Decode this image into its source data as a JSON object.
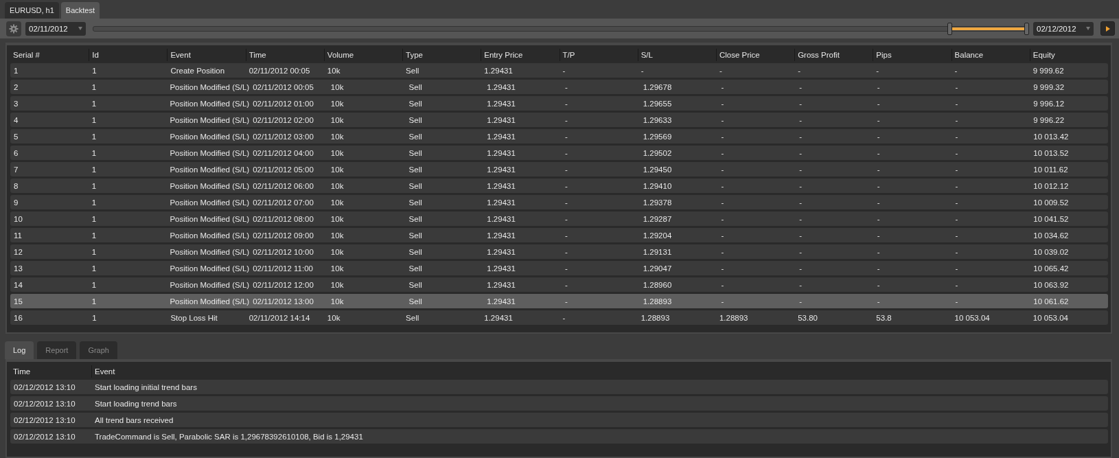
{
  "top_tabs": [
    {
      "label": "EURUSD, h1",
      "selected": false
    },
    {
      "label": "Backtest",
      "selected": true
    }
  ],
  "toolbar": {
    "start_date": "02/11/2012",
    "end_date": "02/12/2012",
    "range_slider": {
      "level": 0.08
    }
  },
  "trades": {
    "columns": [
      "Serial #",
      "Id",
      "Event",
      "Time",
      "Volume",
      "Type",
      "Entry Price",
      "T/P",
      "S/L",
      "Close Price",
      "Gross Profit",
      "Pips",
      "Balance",
      "Equity"
    ],
    "rows": [
      {
        "selected": false,
        "cells": [
          "1",
          "1",
          "Create Position",
          "02/11/2012 00:05",
          "10k",
          "Sell",
          "1.29431",
          "-",
          "-",
          "-",
          "-",
          "-",
          "-",
          "9 999.62"
        ]
      },
      {
        "selected": false,
        "cells": [
          "2",
          "1",
          "Position Modified (S/L)",
          "02/11/2012 00:05",
          "10k",
          "Sell",
          "1.29431",
          "-",
          "1.29678",
          "-",
          "-",
          "-",
          "-",
          "9 999.32"
        ]
      },
      {
        "selected": false,
        "cells": [
          "3",
          "1",
          "Position Modified (S/L)",
          "02/11/2012 01:00",
          "10k",
          "Sell",
          "1.29431",
          "-",
          "1.29655",
          "-",
          "-",
          "-",
          "-",
          "9 996.12"
        ]
      },
      {
        "selected": false,
        "cells": [
          "4",
          "1",
          "Position Modified (S/L)",
          "02/11/2012 02:00",
          "10k",
          "Sell",
          "1.29431",
          "-",
          "1.29633",
          "-",
          "-",
          "-",
          "-",
          "9 996.22"
        ]
      },
      {
        "selected": false,
        "cells": [
          "5",
          "1",
          "Position Modified (S/L)",
          "02/11/2012 03:00",
          "10k",
          "Sell",
          "1.29431",
          "-",
          "1.29569",
          "-",
          "-",
          "-",
          "-",
          "10 013.42"
        ]
      },
      {
        "selected": false,
        "cells": [
          "6",
          "1",
          "Position Modified (S/L)",
          "02/11/2012 04:00",
          "10k",
          "Sell",
          "1.29431",
          "-",
          "1.29502",
          "-",
          "-",
          "-",
          "-",
          "10 013.52"
        ]
      },
      {
        "selected": false,
        "cells": [
          "7",
          "1",
          "Position Modified (S/L)",
          "02/11/2012 05:00",
          "10k",
          "Sell",
          "1.29431",
          "-",
          "1.29450",
          "-",
          "-",
          "-",
          "-",
          "10 011.62"
        ]
      },
      {
        "selected": false,
        "cells": [
          "8",
          "1",
          "Position Modified (S/L)",
          "02/11/2012 06:00",
          "10k",
          "Sell",
          "1.29431",
          "-",
          "1.29410",
          "-",
          "-",
          "-",
          "-",
          "10 012.12"
        ]
      },
      {
        "selected": false,
        "cells": [
          "9",
          "1",
          "Position Modified (S/L)",
          "02/11/2012 07:00",
          "10k",
          "Sell",
          "1.29431",
          "-",
          "1.29378",
          "-",
          "-",
          "-",
          "-",
          "10 009.52"
        ]
      },
      {
        "selected": false,
        "cells": [
          "10",
          "1",
          "Position Modified (S/L)",
          "02/11/2012 08:00",
          "10k",
          "Sell",
          "1.29431",
          "-",
          "1.29287",
          "-",
          "-",
          "-",
          "-",
          "10 041.52"
        ]
      },
      {
        "selected": false,
        "cells": [
          "11",
          "1",
          "Position Modified (S/L)",
          "02/11/2012 09:00",
          "10k",
          "Sell",
          "1.29431",
          "-",
          "1.29204",
          "-",
          "-",
          "-",
          "-",
          "10 034.62"
        ]
      },
      {
        "selected": false,
        "cells": [
          "12",
          "1",
          "Position Modified (S/L)",
          "02/11/2012 10:00",
          "10k",
          "Sell",
          "1.29431",
          "-",
          "1.29131",
          "-",
          "-",
          "-",
          "-",
          "10 039.02"
        ]
      },
      {
        "selected": false,
        "cells": [
          "13",
          "1",
          "Position Modified (S/L)",
          "02/11/2012 11:00",
          "10k",
          "Sell",
          "1.29431",
          "-",
          "1.29047",
          "-",
          "-",
          "-",
          "-",
          "10 065.42"
        ]
      },
      {
        "selected": false,
        "cells": [
          "14",
          "1",
          "Position Modified (S/L)",
          "02/11/2012 12:00",
          "10k",
          "Sell",
          "1.29431",
          "-",
          "1.28960",
          "-",
          "-",
          "-",
          "-",
          "10 063.92"
        ]
      },
      {
        "selected": true,
        "cells": [
          "15",
          "1",
          "Position Modified (S/L)",
          "02/11/2012 13:00",
          "10k",
          "Sell",
          "1.29431",
          "-",
          "1.28893",
          "-",
          "-",
          "-",
          "-",
          "10 061.62"
        ]
      },
      {
        "selected": false,
        "cells": [
          "16",
          "1",
          "Stop Loss Hit",
          "02/11/2012 14:14",
          "10k",
          "Sell",
          "1.29431",
          "-",
          "1.28893",
          "1.28893",
          "53.80",
          "53.8",
          "10 053.04",
          "10 053.04"
        ]
      }
    ]
  },
  "bottom_tabs": [
    {
      "label": "Log",
      "selected": true
    },
    {
      "label": "Report",
      "selected": false
    },
    {
      "label": "Graph",
      "selected": false
    }
  ],
  "log": {
    "columns": [
      "Time",
      "Event"
    ],
    "rows": [
      [
        "02/12/2012 13:10",
        "Start loading initial trend bars"
      ],
      [
        "02/12/2012 13:10",
        "Start loading trend bars"
      ],
      [
        "02/12/2012 13:10",
        "All trend bars received"
      ],
      [
        "02/12/2012 13:10",
        "TradeCommand is Sell, Parabolic SAR is 1,29678392610108, Bid is 1,29431"
      ]
    ]
  }
}
